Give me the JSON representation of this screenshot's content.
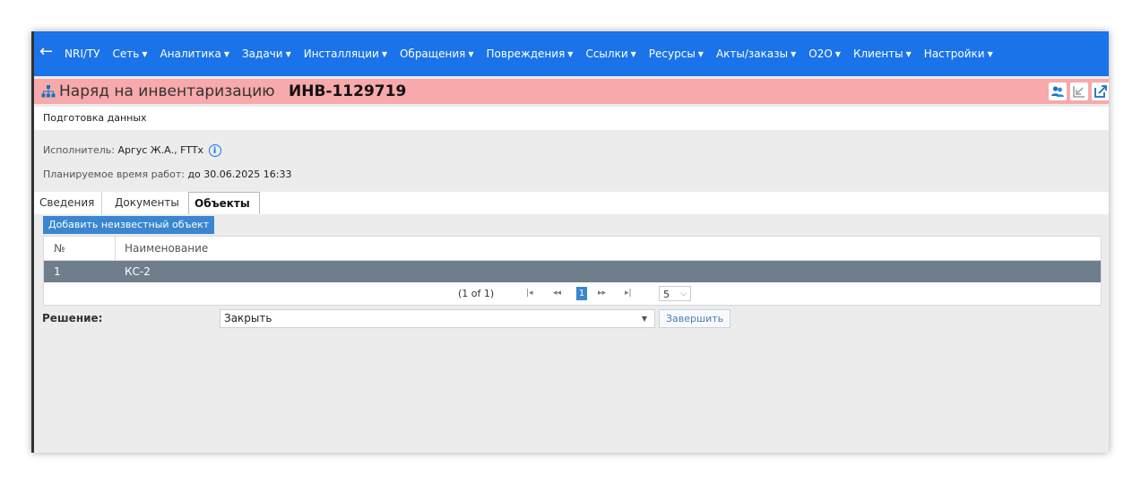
{
  "nav": {
    "back_icon": "arrow-left-icon",
    "items": [
      {
        "label": "NRI/ТУ",
        "has_caret": false
      },
      {
        "label": "Сеть",
        "has_caret": true
      },
      {
        "label": "Аналитика",
        "has_caret": true
      },
      {
        "label": "Задачи",
        "has_caret": true
      },
      {
        "label": "Инсталляции",
        "has_caret": true
      },
      {
        "label": "Обращения",
        "has_caret": true
      },
      {
        "label": "Повреждения",
        "has_caret": true
      },
      {
        "label": "Ссылки",
        "has_caret": true
      },
      {
        "label": "Ресурсы",
        "has_caret": true
      },
      {
        "label": "Акты/заказы",
        "has_caret": true
      },
      {
        "label": "O2O",
        "has_caret": true
      },
      {
        "label": "Клиенты",
        "has_caret": true
      },
      {
        "label": "Настройки",
        "has_caret": true
      }
    ],
    "color": "#1a73e8"
  },
  "header": {
    "title": "Наряд на инвентаризацию",
    "number": "ИНВ-1129719",
    "background": "#f7a9ab"
  },
  "status": "Подготовка данных",
  "executor": {
    "label": "Исполнитель:",
    "value": "Аргус Ж.А., FTTx"
  },
  "planned": {
    "label": "Планируемое время работ:",
    "value": "до 30.06.2025 16:33"
  },
  "tabs": [
    "Сведения",
    "Документы",
    "Объекты"
  ],
  "active_tab": "Объекты",
  "objects": {
    "add_button": "Добавить неизвестный объект",
    "columns": [
      "№",
      "Наименование"
    ],
    "rows": [
      {
        "no": "1",
        "name": "КС-2"
      }
    ],
    "pager": {
      "count": "(1 of 1)",
      "first": "⏮",
      "prev": "«",
      "current": "1",
      "next": "»",
      "last": "⏭",
      "page_size": "5"
    }
  },
  "decision": {
    "label": "Решение:",
    "selected": "Закрыть",
    "finish_button": "Завершить"
  }
}
